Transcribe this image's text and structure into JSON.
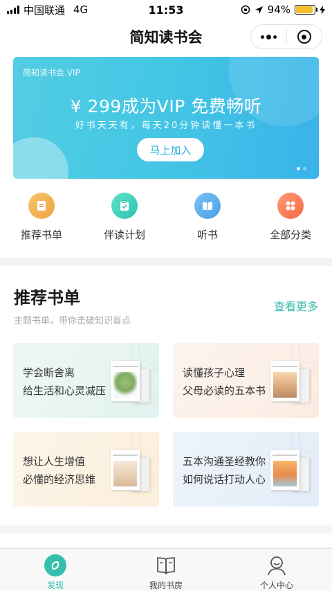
{
  "status_bar": {
    "carrier": "中国联通",
    "network": "4G",
    "time": "11:53",
    "battery": "94%",
    "battery_level": 0.94
  },
  "nav": {
    "title": "简知读书会"
  },
  "banner": {
    "brand": "简知读书会.VIP",
    "headline": "¥ 299成为VIP  免费畅听",
    "subline": "好书天天有，每天20分钟读懂一本书",
    "button": "马上加入"
  },
  "quick_nav": [
    {
      "label": "推荐书单",
      "icon": "booklist-icon",
      "color": "#f3a947"
    },
    {
      "label": "伴读计划",
      "icon": "clipboard-check-icon",
      "color": "#35c6b3"
    },
    {
      "label": "听书",
      "icon": "book-open-icon",
      "color": "#55a7ea"
    },
    {
      "label": "全部分类",
      "icon": "category-grid-icon",
      "color": "#f87249"
    }
  ],
  "recommend": {
    "title": "推荐书单",
    "subtitle": "主题书单，带你击破知识盲点",
    "more": "查看更多",
    "cards": [
      {
        "line1": "学会断舍离",
        "line2": "给生活和心灵减压"
      },
      {
        "line1": "读懂孩子心理",
        "line2": "父母必读的五本书"
      },
      {
        "line1": "想让人生增值",
        "line2": "必懂的经济思维"
      },
      {
        "line1": "五本沟通圣经教你",
        "line2": "如何说话打动人心"
      }
    ]
  },
  "tabs": [
    {
      "label": "发现",
      "icon": "discover-icon",
      "active": true
    },
    {
      "label": "我的书房",
      "icon": "book-icon",
      "active": false
    },
    {
      "label": "个人中心",
      "icon": "user-icon",
      "active": false
    }
  ]
}
